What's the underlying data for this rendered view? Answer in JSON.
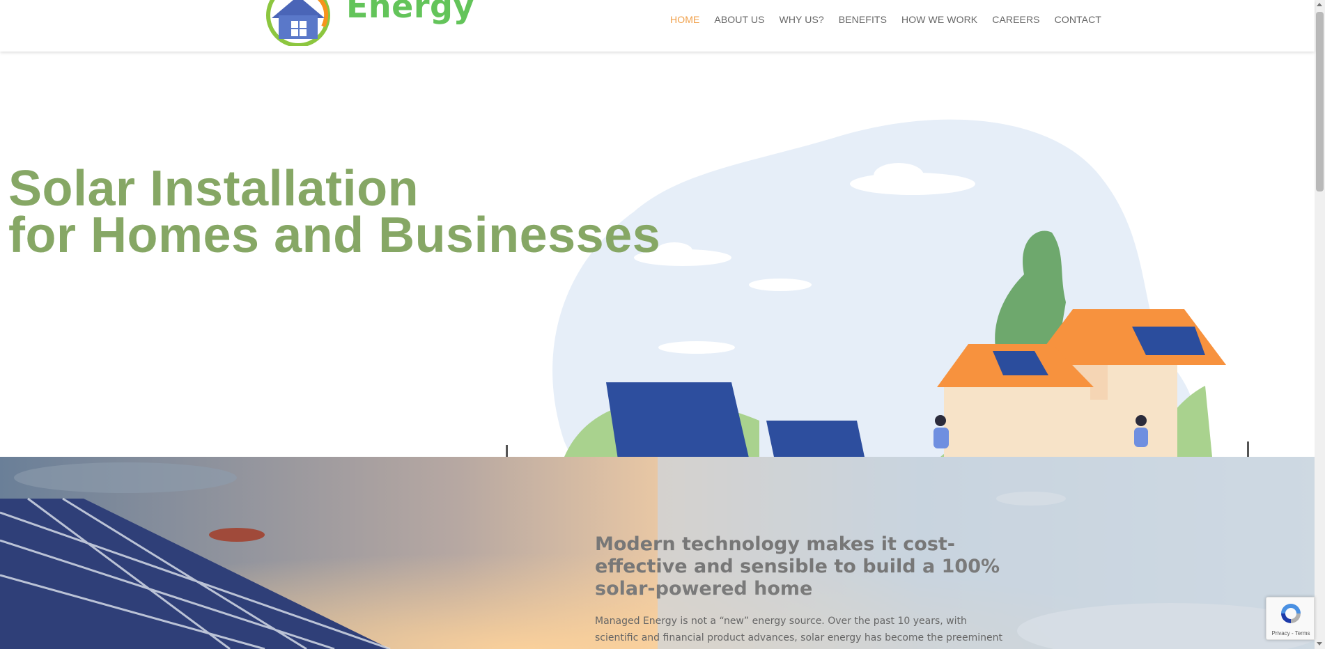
{
  "header": {
    "logo_text": "Energy",
    "nav": [
      {
        "label": "HOME",
        "active": true
      },
      {
        "label": "ABOUT US",
        "active": false
      },
      {
        "label": "WHY US?",
        "active": false
      },
      {
        "label": "BENEFITS",
        "active": false
      },
      {
        "label": "HOW WE WORK",
        "active": false
      },
      {
        "label": "CAREERS",
        "active": false
      },
      {
        "label": "CONTACT",
        "active": false
      }
    ]
  },
  "hero": {
    "title_line1": "Solar Installation",
    "title_line2": "for Homes and Businesses"
  },
  "section": {
    "heading_plain": "Modern technology makes it cost-effective and sensible to build ",
    "heading_bold": "a 100% solar-powered home",
    "body": "Managed Energy is not a “new” energy source. Over the past 10 years, with scientific and financial product advances, solar energy has become the preeminent renewable energy"
  },
  "recaptcha": {
    "links": "Privacy - Terms"
  },
  "colors": {
    "nav_active": "#f0a04a",
    "hero_title": "#86a765",
    "logo_green": "#63c45a"
  }
}
